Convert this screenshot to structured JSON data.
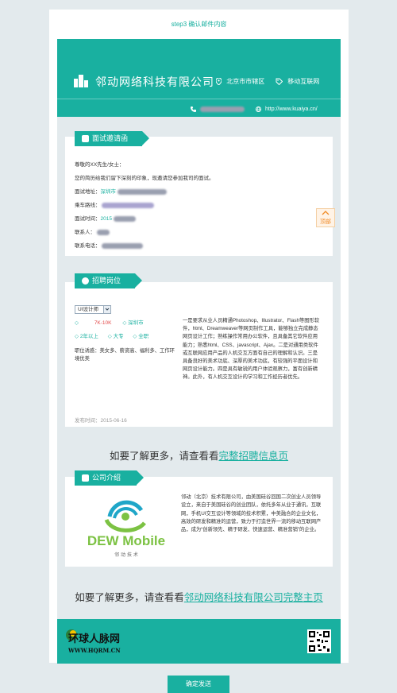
{
  "step_title": "step3 确认邮件内容",
  "header": {
    "company": "邻动网络科技有限公司",
    "location": "北京市市辖区",
    "tag": "移动互联网",
    "website": "http://www.kuaiya.cn/"
  },
  "interview": {
    "tab_label": "面试邀请函",
    "greeting": "尊敬的XX先生/女士：",
    "intro": "您的简历给我们留下深刻的印象，现邀请您参加我司的面试。",
    "address_label": "面试地址：",
    "address_value": "深圳市",
    "route_label": "乘车路线：",
    "time_label": "面试时间：",
    "time_value": "2015",
    "contact_label": "联系人：",
    "phone_label": "联系电话："
  },
  "job": {
    "tab_label": "招聘岗位",
    "selected_position": "UI设计师",
    "salary": "7K-10K",
    "city": "深圳市",
    "experience": "2年以上",
    "education": "大专",
    "type": "全职",
    "benefits": "职位诱惑：美女多、薪资高、福利多、工作环境优美",
    "description": "一是要求从业人员精通Photoshop、Illustrator、Flash等图形软件，html、Dreamweaver等网页制作工具，能够独立完成静态网页设计工作；熟练操作常用办公软件，且具备其它软件应用能力；熟悉html、CSS、javascript、Ajax。二是对通用类软件或互联网应用产品的人机交互方面有自己的理解和认识。三是具备良好的美术功底、深厚的美术功底，有较强的平面设计和网页设计能力。四是具有敏锐的用户体验观察力，富有创新精神。此外，有人机交互设计的学习和工作经历者优先。",
    "publish_date": "发布时间：2015-06-16"
  },
  "more_jobs": {
    "prefix": "如要了解更多，请查看看",
    "link": "完整招聘信息页"
  },
  "company": {
    "tab_label": "公司介绍",
    "logo_text": "DEW Mobile",
    "logo_sub": "邻  动  技  术",
    "intro": "邻动（北京）技术有限公司，由美国硅谷回国二次创业人员领导设立，来自于美国硅谷的创业团队，依托多年从业于通讯，互联网，手机UI交互设计等领域的技术积累，中美融合的企业文化，高效的研发和精准的运营，致力于打造世界一流的移动互联网产品，成为“创新领先、精于研发、快速运营、精准营销”的企业。"
  },
  "more_company": {
    "prefix": "如要了解更多，请查看看",
    "link": "邻动网络科技有限公司完整主页"
  },
  "footer": {
    "brand": "环球人脉网",
    "url": "WWW.HQRM.CN"
  },
  "float_button": "顶部",
  "send_button": "确定发送",
  "colors": {
    "accent": "#19b0a0",
    "background": "#e3eaed",
    "salary": "#e34b4b"
  }
}
